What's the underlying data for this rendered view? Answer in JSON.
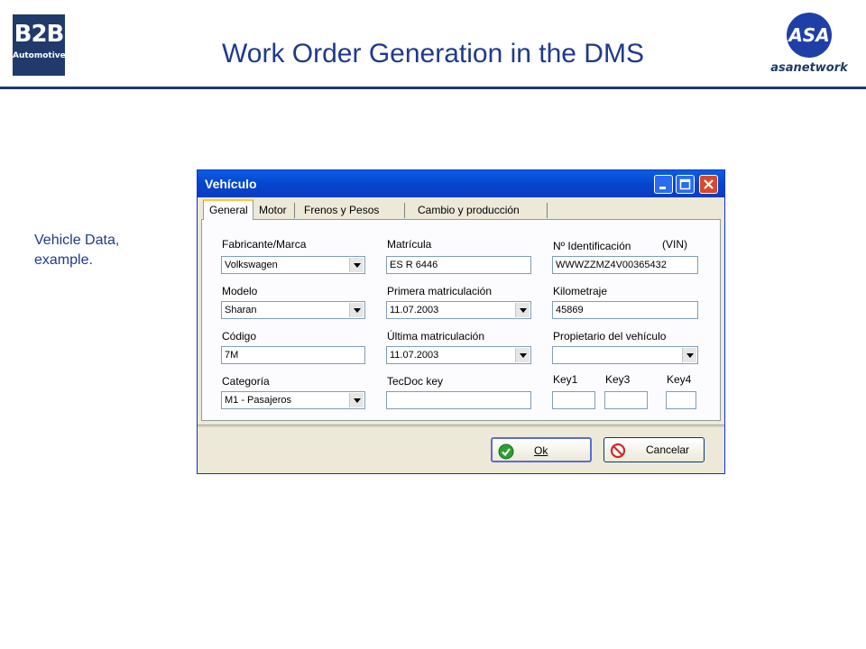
{
  "slide": {
    "title": "Work Order Generation in the DMS",
    "caption_line1": "Vehicle Data,",
    "caption_line2": "example.",
    "logo_left_main": "B2B",
    "logo_left_sub": "Automotive",
    "logo_right_mark": "ASA",
    "logo_right_word": "asanetwork",
    "accent_color": "#1f3a8c"
  },
  "dialog": {
    "title": "Vehículo",
    "tabs": [
      {
        "label": "General",
        "active": true
      },
      {
        "label": "Motor",
        "active": false
      },
      {
        "label": "Frenos y Pesos",
        "active": false
      },
      {
        "label": "Cambio y producción",
        "active": false
      }
    ],
    "fields": {
      "fabricante": {
        "label": "Fabricante/Marca",
        "value": "Volkswagen",
        "type": "select"
      },
      "matricula": {
        "label": "Matrícula",
        "value": "ES R 6446",
        "type": "text"
      },
      "identificacion": {
        "label": "Nº Identificación",
        "label_suffix": "(VIN)",
        "value": "WWWZZMZ4V00365432",
        "type": "text"
      },
      "modelo": {
        "label": "Modelo",
        "value": "Sharan",
        "type": "select"
      },
      "primera": {
        "label": "Primera matriculación",
        "value": "11.07.2003",
        "type": "select"
      },
      "kilometraje": {
        "label": "Kilometraje",
        "value": "45869",
        "type": "text"
      },
      "codigo": {
        "label": "Código",
        "value": "7M",
        "type": "text"
      },
      "ultima": {
        "label": "Última matriculación",
        "value": "11.07.2003",
        "type": "select"
      },
      "propietario": {
        "label": "Propietario del vehículo",
        "value": "",
        "type": "select"
      },
      "categoria": {
        "label": "Categoría",
        "value": "M1 -  Pasajeros",
        "type": "select"
      },
      "tecdoc": {
        "label": "TecDoc key",
        "value": "",
        "type": "text"
      },
      "key1": {
        "label": "Key1",
        "value": "",
        "type": "text"
      },
      "key3": {
        "label": "Key3",
        "value": "",
        "type": "text"
      },
      "key4": {
        "label": "Key4",
        "value": "",
        "type": "text"
      }
    },
    "buttons": {
      "ok_label": "Ok",
      "cancel_label": "Cancelar"
    },
    "icons": {
      "minimize": "minimize-icon",
      "maximize": "maximize-icon",
      "close": "close-icon",
      "ok": "check-circle-icon",
      "cancel": "no-entry-icon"
    }
  }
}
